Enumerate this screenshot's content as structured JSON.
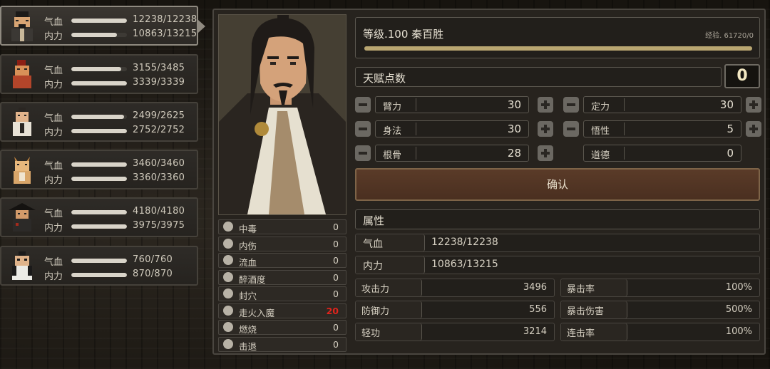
{
  "party": [
    {
      "hp_label": "气血",
      "hp_value": "12238/12238",
      "hp_fraction": 1.0,
      "mp_label": "内力",
      "mp_value": "10863/13215",
      "mp_fraction": 0.82,
      "active": true,
      "avatar_colors": {
        "robe": "#3b3834",
        "skin": "#d8a574",
        "hair": "#1c1a18"
      }
    },
    {
      "hp_label": "气血",
      "hp_value": "3155/3485",
      "hp_fraction": 0.9,
      "mp_label": "内力",
      "mp_value": "3339/3339",
      "mp_fraction": 1.0,
      "active": false,
      "avatar_colors": {
        "robe": "#b3452a",
        "skin": "#d89158",
        "hair": "#8c1f14"
      }
    },
    {
      "hp_label": "气血",
      "hp_value": "2499/2625",
      "hp_fraction": 0.95,
      "mp_label": "内力",
      "mp_value": "2752/2752",
      "mp_fraction": 1.0,
      "active": false,
      "avatar_colors": {
        "robe": "#e8e2d6",
        "skin": "#e2b48c",
        "hair": "#2a2622"
      }
    },
    {
      "hp_label": "气血",
      "hp_value": "3460/3460",
      "hp_fraction": 1.0,
      "mp_label": "内力",
      "mp_value": "3360/3360",
      "mp_fraction": 1.0,
      "active": false,
      "avatar_colors": {
        "robe": "#d9a66a",
        "skin": "#e7b77c",
        "hair": "#c98942"
      }
    },
    {
      "hp_label": "气血",
      "hp_value": "4180/4180",
      "hp_fraction": 1.0,
      "mp_label": "内力",
      "mp_value": "3975/3975",
      "mp_fraction": 1.0,
      "active": false,
      "avatar_colors": {
        "robe": "#2c2a28",
        "skin": "#d29a6a",
        "hair": "#141210"
      }
    },
    {
      "hp_label": "气血",
      "hp_value": "760/760",
      "hp_fraction": 1.0,
      "mp_label": "内力",
      "mp_value": "870/870",
      "mp_fraction": 1.0,
      "active": false,
      "avatar_colors": {
        "robe": "#ecebe6",
        "skin": "#e0b38a",
        "hair": "#1b1a1a"
      }
    }
  ],
  "statuses": [
    {
      "name": "中毒",
      "value": "0",
      "icon": "skull-icon",
      "highlight": false
    },
    {
      "name": "内伤",
      "value": "0",
      "icon": "broken-heart-icon",
      "highlight": false
    },
    {
      "name": "流血",
      "value": "0",
      "icon": "blood-drop-icon",
      "highlight": false
    },
    {
      "name": "醉酒度",
      "value": "0",
      "icon": "drunk-face-icon",
      "highlight": false
    },
    {
      "name": "封穴",
      "value": "0",
      "icon": "acupoint-icon",
      "highlight": false
    },
    {
      "name": "走火入魔",
      "value": "20",
      "icon": "demon-mask-icon",
      "highlight": true
    },
    {
      "name": "燃烧",
      "value": "0",
      "icon": "flame-icon",
      "highlight": false
    },
    {
      "name": "击退",
      "value": "0",
      "icon": "boot-icon",
      "highlight": false
    }
  ],
  "header": {
    "title": "等级.100 秦百胜",
    "exp_text": "经验. 61720/0",
    "exp_fraction": 1.0
  },
  "talent": {
    "label": "天赋点数",
    "points": "0"
  },
  "attributes": [
    {
      "name": "臂力",
      "value": "30",
      "editable": true
    },
    {
      "name": "定力",
      "value": "30",
      "editable": true
    },
    {
      "name": "身法",
      "value": "30",
      "editable": true
    },
    {
      "name": "悟性",
      "value": "5",
      "editable": true
    },
    {
      "name": "根骨",
      "value": "28",
      "editable": true
    },
    {
      "name": "道德",
      "value": "0",
      "editable": false
    }
  ],
  "confirm_label": "确认",
  "properties": {
    "label": "属性",
    "hp": {
      "name": "气血",
      "value": "12238/12238"
    },
    "mp": {
      "name": "内力",
      "value": "10863/13215"
    },
    "combat": [
      {
        "name": "攻击力",
        "value": "3496"
      },
      {
        "name": "暴击率",
        "value": "100%"
      },
      {
        "name": "防御力",
        "value": "556"
      },
      {
        "name": "暴击伤害",
        "value": "500%"
      },
      {
        "name": "轻功",
        "value": "3214"
      },
      {
        "name": "连击率",
        "value": "100%"
      }
    ]
  }
}
